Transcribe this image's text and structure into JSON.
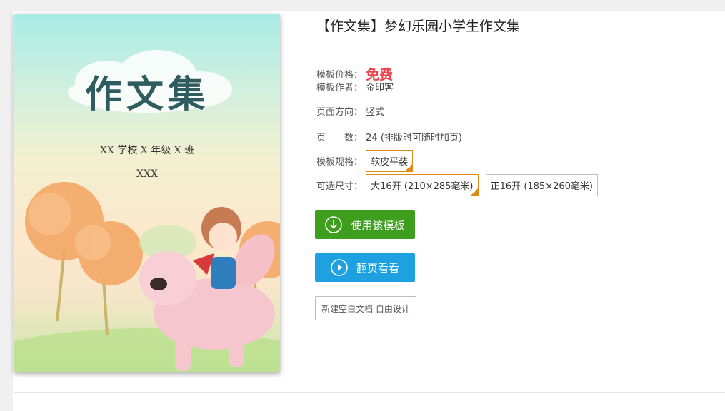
{
  "product": {
    "title": "【作文集】梦幻乐园小学生作文集"
  },
  "cover": {
    "title": "作文集",
    "school_line": "XX 学校 X 年级 X 班",
    "name_line": "XXX"
  },
  "details": {
    "price_label": "模板价格：",
    "price_value": "免费",
    "author_label": "模板作者：",
    "author_value": "金印客",
    "orientation_label": "页面方向：",
    "orientation_value": "竖式",
    "pages_label": "页　　数：",
    "pages_value": "24 (排版时可随时加页)",
    "spec_label": "模板规格：",
    "spec_options": [
      "软皮平装"
    ],
    "size_label": "可选尺寸：",
    "size_options": [
      "大16开 (210×285毫米)",
      "正16开 (185×260毫米)"
    ]
  },
  "actions": {
    "use_template": "使用该模板",
    "flip_preview": "翻页看看",
    "new_blank": "新建空白文档 自由设计"
  },
  "colors": {
    "price": "#e8424a",
    "selected_border": "#e08a16",
    "green_button": "#3e9e1d",
    "blue_button": "#1da1e1"
  }
}
